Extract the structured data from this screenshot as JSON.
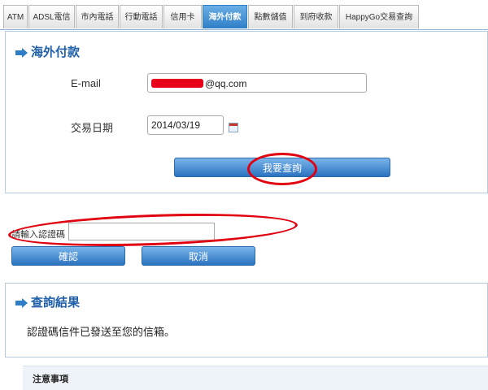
{
  "tabs": [
    {
      "label": "ATM"
    },
    {
      "label": "ADSL電信"
    },
    {
      "label": "市內電話"
    },
    {
      "label": "行動電話"
    },
    {
      "label": "信用卡"
    },
    {
      "label": "海外付款",
      "active": true
    },
    {
      "label": "點數儲值"
    },
    {
      "label": "到府收款"
    },
    {
      "label": "HappyGo交易查詢"
    }
  ],
  "query_panel": {
    "title": "海外付款",
    "email_label": "E-mail",
    "email_value": "@qq.com",
    "date_label": "交易日期",
    "date_value": "2014/03/19",
    "query_button": "我要查詢"
  },
  "verify": {
    "code_label": "請輸入認證碼",
    "confirm_button": "確認",
    "cancel_button": "取消"
  },
  "result_panel": {
    "title": "查詢結果",
    "message": "認證碼信件已發送至您的信箱。"
  },
  "notice": {
    "title": "注意事項"
  },
  "colors": {
    "accent": "#2f7fc8",
    "highlight": "#e00010"
  }
}
